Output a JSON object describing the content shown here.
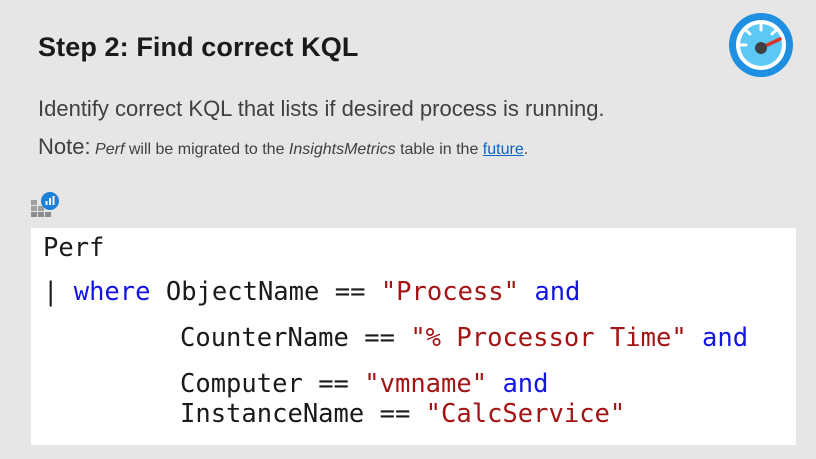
{
  "slide": {
    "title": "Step 2: Find correct KQL",
    "description": "Identify correct KQL that lists if desired process is running.",
    "note": {
      "label": "Note:",
      "italic_1": "Perf",
      "text_1": " will be migrated to the ",
      "italic_2": "InsightsMetrics",
      "text_2": " table in the ",
      "link": "future",
      "text_3": "."
    }
  },
  "icons": {
    "top_right": "gauge-icon",
    "query": "kusto-query-icon"
  },
  "code": {
    "line1": {
      "table": "Perf"
    },
    "line2": {
      "pipe": "|",
      "where": "where",
      "field": "ObjectName",
      "op": "==",
      "value": "\"Process\"",
      "and": "and"
    },
    "line3": {
      "field": "CounterName",
      "op": "==",
      "value": "\"% Processor Time\"",
      "and": "and"
    },
    "line4": {
      "field": "Computer",
      "op": "==",
      "value": "\"vmname\"",
      "and": "and"
    },
    "line5": {
      "field": "InstanceName",
      "op": "==",
      "value": "\"CalcService\""
    }
  },
  "colors": {
    "background": "#e6e6e6",
    "keyword": "#1414e6",
    "string": "#a31515",
    "link": "#0a63c9",
    "gauge_ring": "#1e8fe1",
    "gauge_needle": "#d9342b"
  }
}
